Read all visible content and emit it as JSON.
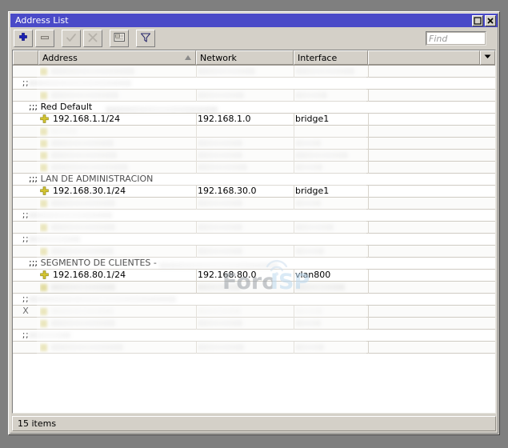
{
  "window": {
    "title": "Address List",
    "buttons": [
      {
        "name": "maximize",
        "glyph": "maximize-icon"
      },
      {
        "name": "close",
        "glyph": "close-icon"
      }
    ]
  },
  "toolbar": {
    "buttons": [
      {
        "name": "add-button",
        "icon": "plus-icon",
        "enabled": true,
        "tooltip": "Add"
      },
      {
        "name": "remove-button",
        "icon": "minus-icon",
        "enabled": true,
        "tooltip": "Remove"
      },
      {
        "name": "enable-button",
        "icon": "check-icon",
        "enabled": false,
        "tooltip": "Enable"
      },
      {
        "name": "disable-button",
        "icon": "cross-icon",
        "enabled": false,
        "tooltip": "Disable"
      },
      {
        "name": "comment-button",
        "icon": "comment-icon",
        "enabled": true,
        "tooltip": "Comment"
      },
      {
        "name": "filter-button",
        "icon": "funnel-icon",
        "enabled": true,
        "tooltip": "Filter"
      }
    ],
    "find": {
      "placeholder": "Find",
      "value": ""
    }
  },
  "table": {
    "columns": [
      {
        "key": "flag",
        "label": ""
      },
      {
        "key": "address",
        "label": "Address",
        "sorted": "asc"
      },
      {
        "key": "network",
        "label": "Network"
      },
      {
        "key": "interface",
        "label": "Interface"
      },
      {
        "key": "extra",
        "label": ""
      }
    ],
    "rows": [
      {
        "type": "data",
        "flag": "",
        "redacted": true,
        "address": "",
        "network": "",
        "interface": "",
        "widths": [
          104,
          72,
          74
        ]
      },
      {
        "type": "comment",
        "redacted": true,
        "text": "",
        "comment_width": 128
      },
      {
        "type": "data",
        "flag": "",
        "redacted": true,
        "address": "",
        "network": "",
        "interface": "",
        "widths": [
          84,
          58,
          40
        ]
      },
      {
        "type": "comment",
        "redacted": false,
        "text": ";;; Red Default",
        "trail_width": 140
      },
      {
        "type": "data",
        "flag": "",
        "redacted": false,
        "address": "192.168.1.1/24",
        "network": "192.168.1.0",
        "interface": "bridge1"
      },
      {
        "type": "data",
        "flag": "",
        "redacted": true,
        "address": "",
        "network": "",
        "interface": "",
        "widths": [
          32,
          0,
          0
        ],
        "faint": true
      },
      {
        "type": "data",
        "flag": "",
        "redacted": true,
        "address": "",
        "network": "",
        "interface": "",
        "widths": [
          78,
          56,
          32
        ]
      },
      {
        "type": "data",
        "flag": "",
        "redacted": true,
        "address": "",
        "network": "",
        "interface": "",
        "widths": [
          82,
          56,
          66
        ]
      },
      {
        "type": "data",
        "flag": "",
        "redacted": true,
        "address": "",
        "network": "",
        "interface": "",
        "widths": [
          96,
          62,
          34
        ]
      },
      {
        "type": "comment",
        "redacted": false,
        "text": ";;; LAN DE ADMINISTRACION",
        "trail_width": 0
      },
      {
        "type": "data",
        "flag": "",
        "redacted": false,
        "address": "192.168.30.1/24",
        "network": "192.168.30.0",
        "interface": "bridge1"
      },
      {
        "type": "data",
        "flag": "",
        "redacted": true,
        "address": "",
        "network": "",
        "interface": "",
        "widths": [
          80,
          56,
          32
        ]
      },
      {
        "type": "comment",
        "redacted": true,
        "text": "",
        "comment_width": 104
      },
      {
        "type": "data",
        "flag": "",
        "redacted": true,
        "address": "",
        "network": "",
        "interface": "",
        "widths": [
          80,
          56,
          48
        ]
      },
      {
        "type": "comment",
        "redacted": true,
        "text": "",
        "comment_width": 64
      },
      {
        "type": "data",
        "flag": "",
        "redacted": true,
        "address": "",
        "network": "",
        "interface": "",
        "widths": [
          78,
          56,
          36
        ]
      },
      {
        "type": "comment",
        "redacted": false,
        "text": ";;; SEGMENTO DE CLIENTES -",
        "trail_width": 148
      },
      {
        "type": "data",
        "flag": "",
        "redacted": false,
        "address": "192.168.80.1/24",
        "network": "192.168.80.0",
        "interface": "vlan800"
      },
      {
        "type": "data",
        "flag": "",
        "redacted": true,
        "address": "",
        "network": "",
        "interface": "",
        "widths": [
          80,
          54,
          62
        ]
      },
      {
        "type": "comment",
        "redacted": true,
        "text": "",
        "comment_width": 184
      },
      {
        "type": "data",
        "flag": "X",
        "redacted": true,
        "address": "",
        "network": "",
        "interface": "",
        "widths": [
          78,
          54,
          34
        ],
        "faint": true
      },
      {
        "type": "data",
        "flag": "",
        "redacted": true,
        "address": "",
        "network": "",
        "interface": "",
        "widths": [
          80,
          56,
          32
        ]
      },
      {
        "type": "comment",
        "redacted": true,
        "text": "",
        "comment_width": 52
      },
      {
        "type": "data",
        "flag": "",
        "redacted": true,
        "address": "",
        "network": "",
        "interface": "",
        "widths": [
          90,
          58,
          36
        ]
      }
    ]
  },
  "statusbar": {
    "text": "15 items"
  },
  "watermark": {
    "text_primary": "Foro",
    "text_secondary": "ISP",
    "color_primary": "#9aa0a6",
    "color_secondary": "#bcd9ef"
  },
  "colors": {
    "titlebar": "#4a4ac8",
    "chrome": "#d4d0c8",
    "desktop": "#7f7f7f",
    "grid_line": "#cfcbc2",
    "address_icon": "#d4c531"
  }
}
